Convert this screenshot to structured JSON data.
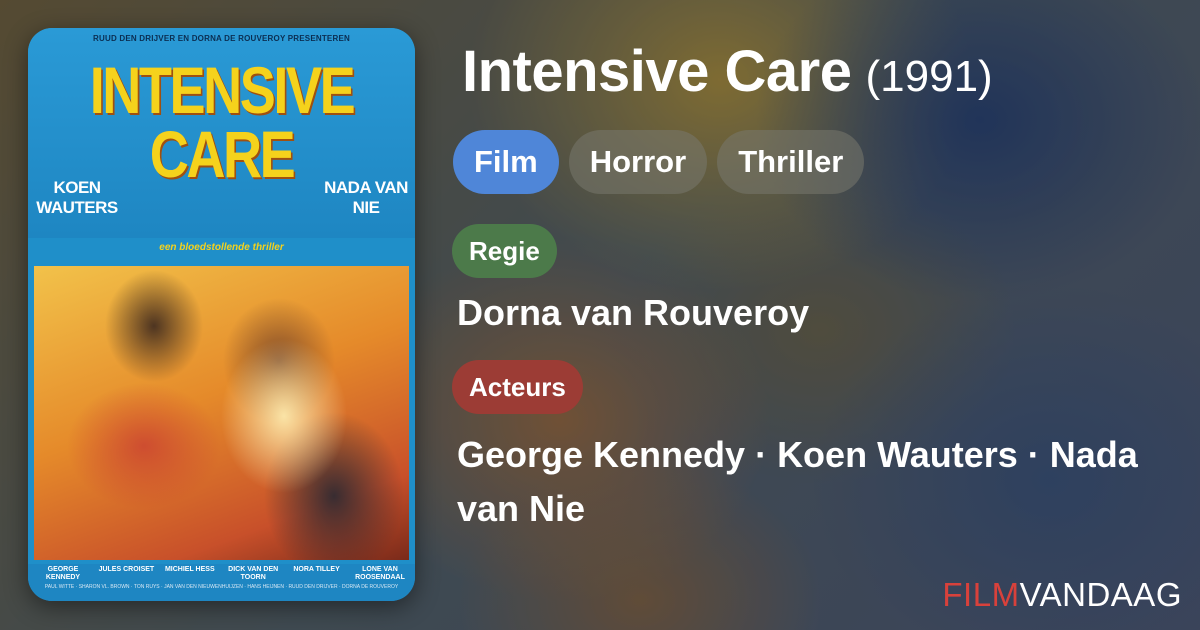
{
  "movie": {
    "title": "Intensive Care",
    "year": "(1991)"
  },
  "tags": [
    "Film",
    "Horror",
    "Thriller"
  ],
  "sections": {
    "director_label": "Regie",
    "director": "Dorna van Rouveroy",
    "actors_label": "Acteurs",
    "actors": "George Kennedy · Koen Wauters · Nada van Nie"
  },
  "poster": {
    "presenters": "RUUD DEN DRIJVER EN DORNA DE ROUVEROY PRESENTEREN",
    "title_line1": "INTENSIVE",
    "title_line2": "CARE",
    "actor_left": "KOEN WAUTERS",
    "actor_right": "NADA VAN NIE",
    "tagline": "een bloedstollende thriller",
    "credits": [
      "GEORGE KENNEDY",
      "JULES CROISET",
      "MICHIEL HESS",
      "DICK VAN DEN TOORN",
      "NORA TILLEY",
      "LONE VAN ROOSENDAAL"
    ],
    "credits_small": "PAUL WITTE · SHARON VL. BROWN · TON RUYS · JAN VAN DEN NIEUWENHUIJZEN · HANS HEIJNEN · RUUD DEN DRIJVER · DORNA DE ROUVEROY"
  },
  "brand": {
    "part1": "FILM",
    "part2": "VANDAAG"
  },
  "colors": {
    "tag_primary": "#4f86d8",
    "label_regie": "#4c7a4a",
    "label_acteurs": "#9c3c35",
    "brand_red": "#d8413b"
  }
}
